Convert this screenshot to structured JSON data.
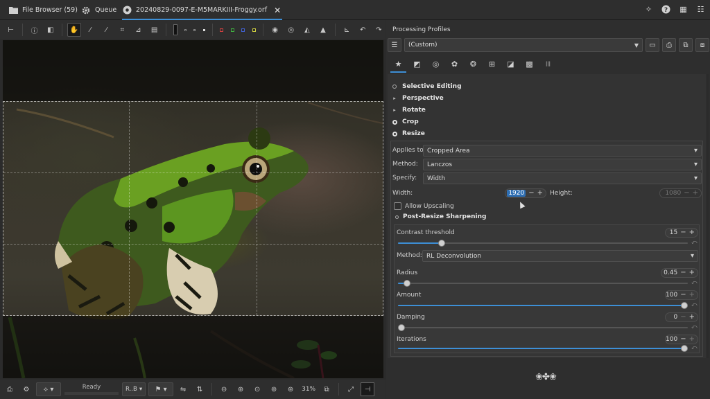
{
  "tabs": [
    {
      "label": "File Browser (59)",
      "icon": "folder-icon"
    },
    {
      "label": "Queue",
      "icon": "gear-icon"
    },
    {
      "label": "20240829-0097-E-M5MARKIII-Froggy.orf",
      "icon": "aperture-icon",
      "active": true
    }
  ],
  "status": {
    "ready_label": "Ready",
    "preview_mode": "R..B",
    "zoom": "31%"
  },
  "profiles": {
    "title": "Processing Profiles",
    "current": "(Custom)"
  },
  "tools": {
    "selective_editing": "Selective Editing",
    "perspective": "Perspective",
    "rotate": "Rotate",
    "crop": "Crop",
    "resize": "Resize"
  },
  "resize": {
    "applies_to_label": "Applies to:",
    "applies_to_value": "Cropped Area",
    "method_label": "Method:",
    "method_value": "Lanczos",
    "specify_label": "Specify:",
    "specify_value": "Width",
    "width_label": "Width:",
    "width_value": "1920",
    "height_label": "Height:",
    "height_value": "1080",
    "allow_upscaling_label": "Allow Upscaling"
  },
  "sharpening": {
    "title": "Post-Resize Sharpening",
    "contrast_label": "Contrast threshold",
    "contrast_value": "15",
    "contrast_level": 0.15,
    "method_label": "Method:",
    "method_value": "RL Deconvolution",
    "radius_label": "Radius",
    "radius_value": "0.45",
    "radius_level": 0.03,
    "amount_label": "Amount",
    "amount_value": "100",
    "amount_level": 1.0,
    "damping_label": "Damping",
    "damping_value": "0",
    "damping_level": 0.0,
    "iterations_label": "Iterations",
    "iterations_value": "100",
    "iterations_level": 1.0
  },
  "colors": {
    "accent": "#3d8fd6",
    "background": "#2e2e2e"
  }
}
